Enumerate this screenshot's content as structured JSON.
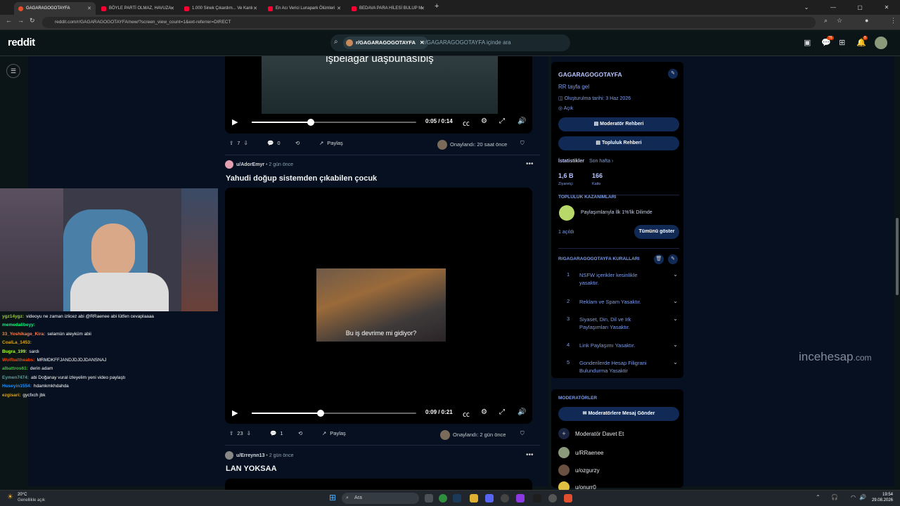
{
  "browser": {
    "tabs": [
      {
        "label": "GAGARAGOGOTAYFA",
        "active": true
      },
      {
        "label": "BÖYLE PARTİ OLMAZ, HAVUZA"
      },
      {
        "label": "1.000 Sinek Çıkardım... Ve Kanlı"
      },
      {
        "label": "En Acı Verici Lunapark Ölümleri"
      },
      {
        "label": "BEDAVA PARA HİLESİ BULUP M"
      }
    ],
    "url": "reddit.com/r/GAGARAGOGOTAYFA/new/?screen_view_count=1&ext-referrer=DIRECT"
  },
  "header": {
    "logo": "reddit",
    "search_chip": "r/GAGARAGOGOTAYFA",
    "search_placeholder": "r/GAGARAGOGOTAYFA içinde ara",
    "chat_badge": "76",
    "notif_badge": "8"
  },
  "post1": {
    "subtitle": "işbelagar uaşbunasıbiş",
    "time": "0:05 / 0:14",
    "progress": 0.36,
    "votes": "7",
    "comments": "0",
    "share": "Paylaş",
    "approved": "Onaylandı: 20 saat önce"
  },
  "post2": {
    "user": "u/AdorEmyr",
    "age": "• 2 gün önce",
    "title": "Yahudi doğup sistemden çıkabilen çocuk",
    "caption": "Bu iş devrime mi gidiyor?",
    "time": "0:09 / 0:21",
    "progress": 0.42,
    "votes": "23",
    "comments": "1",
    "share": "Paylaş",
    "approved": "Onaylandı: 2 gün önce"
  },
  "post3": {
    "user": "u/Erreynn13",
    "age": "• 2 gün önce",
    "title": "LAN YOKSAA"
  },
  "chat": [
    {
      "user": "ygz14ygz:",
      "msg": "videoyu ne zaman izlicez abi @RRaenee abi lütfen cevaplaaaa",
      "color": "#9acd32"
    },
    {
      "user": "memedalibeyy:",
      "msg": "",
      "color": "#00ff7f"
    },
    {
      "user": "33_Yoshikage_Kira:",
      "msg": "selamün aleyküm abii",
      "color": "#ff7f50"
    },
    {
      "user": "CoalLa_1453:",
      "msg": "",
      "color": "#daa520"
    },
    {
      "user": "Bugra_199:",
      "msg": "sardı",
      "color": "#adff2f"
    },
    {
      "user": "Wolfbaltheabs:",
      "msg": "MRMDKFFJANDJDJDJDANSNAJ",
      "color": "#ff4500"
    },
    {
      "user": "albattros61:",
      "msg": "derin adam",
      "color": "#32cd32"
    },
    {
      "user": "Eymen7474:",
      "msg": "abi Doğanay vural izleyelim yeni video paylaştı",
      "color": "#5f9ea0"
    },
    {
      "user": "Huseyin1554:",
      "msg": "hdamkmkhdahda",
      "color": "#1e90ff"
    },
    {
      "user": "ezgisari:",
      "msg": "gycfxch jbk",
      "color": "#daa520"
    }
  ],
  "sidebar": {
    "community": "GAGARAGOGOTAYFA",
    "description": "RR tayfa gel",
    "created": "Oluşturulma tarihi: 3 Haz 2026",
    "visibility": "Açık",
    "mod_guide": "Moderatör Rehberi",
    "community_guide": "Topluluk Rehberi",
    "stats_label": "İstatistikler",
    "stats_period": "Son hafta ›",
    "visitors_value": "1,6 B",
    "visitors_label": "Ziyaretçi",
    "contrib_value": "166",
    "contrib_label": "Katkı",
    "earnings_title": "TOPLULUK KAZANIMLARI",
    "earnings_item": "Paylaşımlarıyla İlk 1%'lik Dilimde",
    "unlocked": "1 açıldı",
    "show_all": "Tümünü göster",
    "rules_title": "R/GAGARAGOGOTAYFA KURALLARI",
    "rules": [
      {
        "n": "1",
        "text": "NSFW içerikler kesinlikle yasaktır."
      },
      {
        "n": "2",
        "text": "Reklam ve Spam Yasaktır."
      },
      {
        "n": "3",
        "text": "Siyaset, Din, Dil ve Irk Paylaşımları Yasaktır."
      },
      {
        "n": "4",
        "text": "Link Paylaşımı Yasaktır."
      },
      {
        "n": "5",
        "text": "Gonderilerde Hesap Filigrani Bulundurma Yasaktir"
      }
    ],
    "mods_title": "MODERATÖRLER",
    "message_mods": "Moderatörlere Mesaj Gönder",
    "invite_mod": "Moderatör Davet Et",
    "mods": [
      "u/RRaenee",
      "u/ozgurzy",
      "u/onurr0"
    ]
  },
  "watermark": {
    "text": "incehesap",
    "suffix": ".com"
  },
  "taskbar": {
    "weather_temp": "20°C",
    "weather_desc": "Genellikle açık",
    "search": "Ara",
    "time": "19:54",
    "date": "29.08.2026"
  }
}
